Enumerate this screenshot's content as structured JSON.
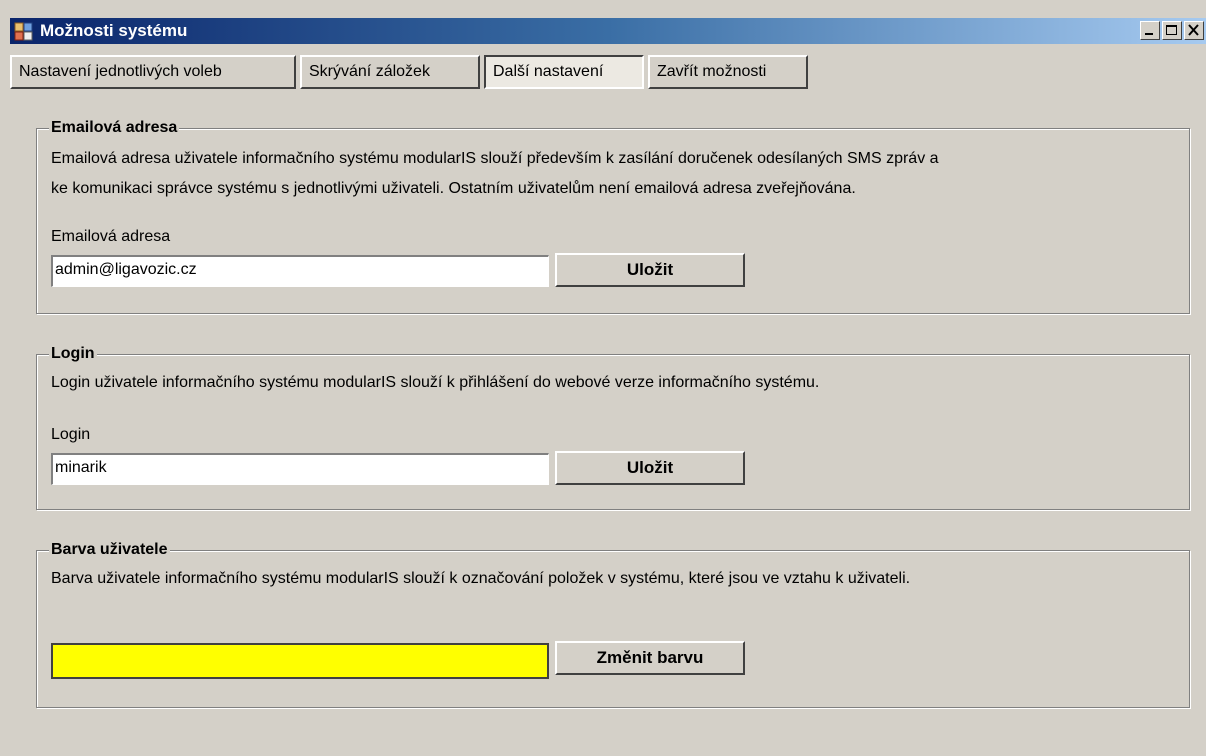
{
  "window": {
    "title": "Možnosti systému"
  },
  "tabs": [
    {
      "label": "Nastavení jednotlivých voleb",
      "active": false
    },
    {
      "label": "Skrývání záložek",
      "active": false
    },
    {
      "label": "Další nastavení",
      "active": true
    },
    {
      "label": "Zavřít možnosti",
      "active": false
    }
  ],
  "email_group": {
    "title": "Emailová adresa",
    "description_line1": "Emailová adresa uživatele informačního systému modularIS slouží především k zasílání doručenek odesílaných SMS zpráv a",
    "description_line2": "ke komunikaci správce systému s jednotlivými uživateli. Ostatním uživatelům není emailová adresa zveřejňována.",
    "field_label": "Emailová adresa",
    "field_value": "admin@ligavozic.cz",
    "save_label": "Uložit"
  },
  "login_group": {
    "title": "Login",
    "description": "Login uživatele informačního systému modularIS slouží k přihlášení do webové verze informačního systému.",
    "field_label": "Login",
    "field_value": "minarik",
    "save_label": "Uložit"
  },
  "color_group": {
    "title": "Barva uživatele",
    "description": "Barva uživatele informačního systému modularIS slouží k označování položek v systému, které jsou ve vztahu k uživateli.",
    "color": "#ffff00",
    "change_label": "Změnit barvu"
  },
  "icons": {
    "app": "app-icon",
    "minimize": "minimize-icon",
    "maximize": "maximize-icon",
    "close": "close-icon"
  }
}
